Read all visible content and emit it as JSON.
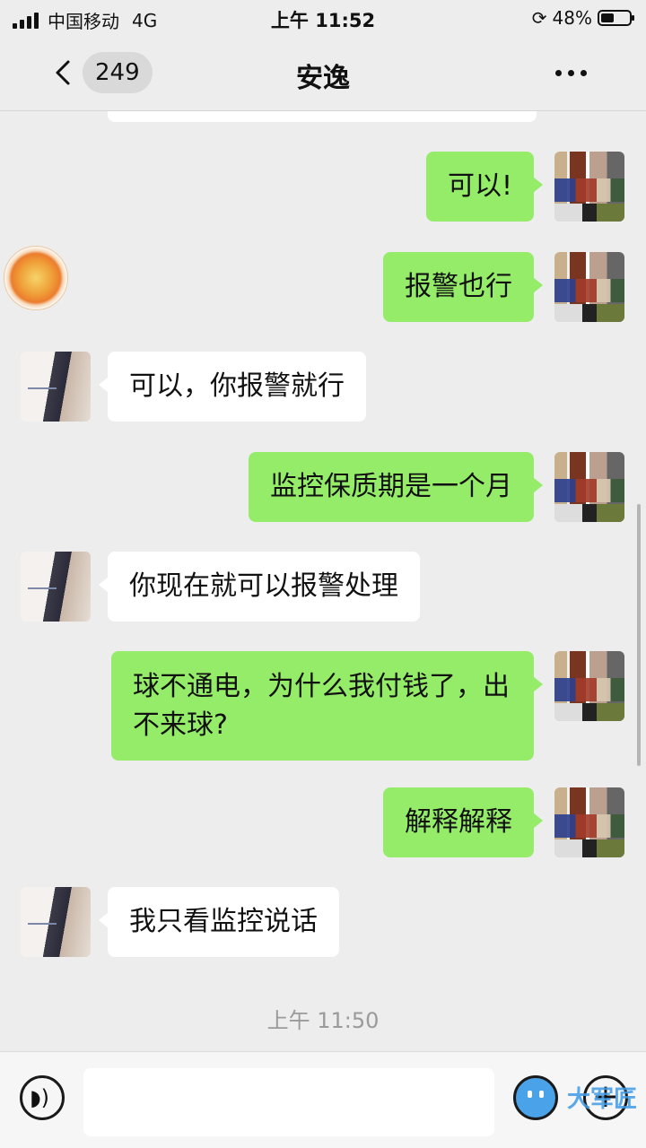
{
  "status_bar": {
    "carrier": "中国移动",
    "network": "4G",
    "time": "上午 11:52",
    "battery_percent": "48%",
    "battery_level": 0.48
  },
  "nav": {
    "back_icon": "chevron-left-icon",
    "unread_count": "249",
    "title": "安逸",
    "more_icon": "more-dots-icon"
  },
  "messages": [
    {
      "from": "me",
      "text": "可以!"
    },
    {
      "from": "me",
      "text": "报警也行"
    },
    {
      "from": "them",
      "text": "可以，你报警就行"
    },
    {
      "from": "me",
      "text": "监控保质期是一个月"
    },
    {
      "from": "them",
      "text": "你现在就可以报警处理"
    },
    {
      "from": "me",
      "text": "球不通电，为什么我付钱了，出不来球?"
    },
    {
      "from": "me",
      "text": "解释解释"
    },
    {
      "from": "them",
      "text": "我只看监控说话"
    }
  ],
  "timestamp": "上午 11:50",
  "input_bar": {
    "voice_icon": "voice-icon",
    "emoji_icon": "emoji-icon",
    "plus_icon": "plus-icon",
    "watermark": "大军匠"
  },
  "colors": {
    "my_bubble": "#95ec69",
    "their_bubble": "#ffffff",
    "background": "#ededed"
  }
}
